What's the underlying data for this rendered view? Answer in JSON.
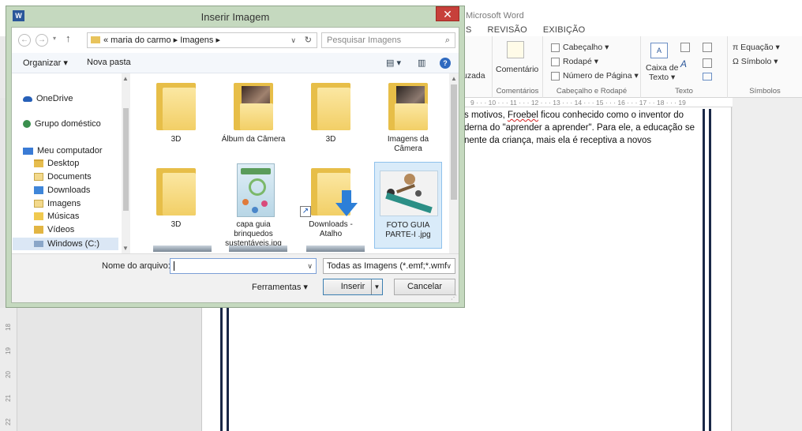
{
  "word": {
    "title": "Microsoft Word",
    "tabs": [
      "S",
      "REVISÃO",
      "EXIBIÇÃO"
    ],
    "ribbon": {
      "partial_word": "uzada",
      "comment_label": "Comentário",
      "comments_group": "Comentários",
      "header_label": "Cabeçalho ▾",
      "footer_label": "Rodapé ▾",
      "page_number_label": "Número de Página ▾",
      "header_footer_group": "Cabeçalho e Rodapé",
      "textbox_label_1": "Caixa de",
      "textbox_label_2": "Texto ▾",
      "text_group": "Texto",
      "equation_label": "π Equação ▾",
      "symbol_label": "Ω Símbolo ▾",
      "symbols_group": "Símbolos"
    },
    "ruler": "9 · · · 10 · · · 11 · · · 12 · · · 13 · · · 14 · · · 15 · · · 16 · · · 17 · · 18 · · · 19",
    "doc_lines": {
      "line1_a": "s motivos, ",
      "line1_b": "Froebel",
      "line1_c": " ficou conhecido como o inventor do",
      "line2": "derna do \"aprender a aprender\". Para ele, a educação se",
      "line3": "nente da criança, mais ela é receptiva a novos"
    },
    "vruler": [
      "18",
      "19",
      "20",
      "21",
      "22"
    ]
  },
  "dialog": {
    "title": "Inserir Imagem",
    "close": "✕",
    "app_icon": "W",
    "address": "« maria do carmo ▸ Imagens ▸",
    "search_placeholder": "Pesquisar Imagens",
    "toolbar": {
      "organize": "Organizar ▾",
      "new_folder": "Nova pasta"
    },
    "sidebar": [
      {
        "label": "OneDrive",
        "icon": "cloud-icon"
      },
      {
        "label": "Grupo doméstico",
        "icon": "homegroup-icon"
      },
      {
        "label": "Meu computador",
        "icon": "computer-icon"
      },
      {
        "label": "Desktop",
        "icon": "desktop-folder-icon"
      },
      {
        "label": "Documents",
        "icon": "documents-folder-icon"
      },
      {
        "label": "Downloads",
        "icon": "downloads-folder-icon"
      },
      {
        "label": "Imagens",
        "icon": "pictures-folder-icon"
      },
      {
        "label": "Músicas",
        "icon": "music-folder-icon"
      },
      {
        "label": "Vídeos",
        "icon": "videos-folder-icon"
      },
      {
        "label": "Windows (C:)",
        "icon": "drive-icon"
      }
    ],
    "files": [
      {
        "label": "3D",
        "type": "folder"
      },
      {
        "label": "Álbum da Câmera",
        "type": "photo-folder"
      },
      {
        "label": "3D",
        "type": "folder"
      },
      {
        "label": "Imagens da Câmera",
        "type": "photo-folder"
      },
      {
        "label": "3D",
        "type": "folder"
      },
      {
        "label": "capa guia brinquedos sustentáveis.jpg",
        "type": "image"
      },
      {
        "label": "Downloads - Atalho",
        "type": "shortcut"
      },
      {
        "label": "FOTO GUIA PARTE-I .jpg",
        "type": "image-selected"
      }
    ],
    "file_name_label": "Nome do arquivo:",
    "file_name_value": "",
    "filter": "Todas as Imagens (*.emf;*.wmf",
    "tools": "Ferramentas ▾",
    "insert": "Inserir",
    "cancel": "Cancelar"
  }
}
